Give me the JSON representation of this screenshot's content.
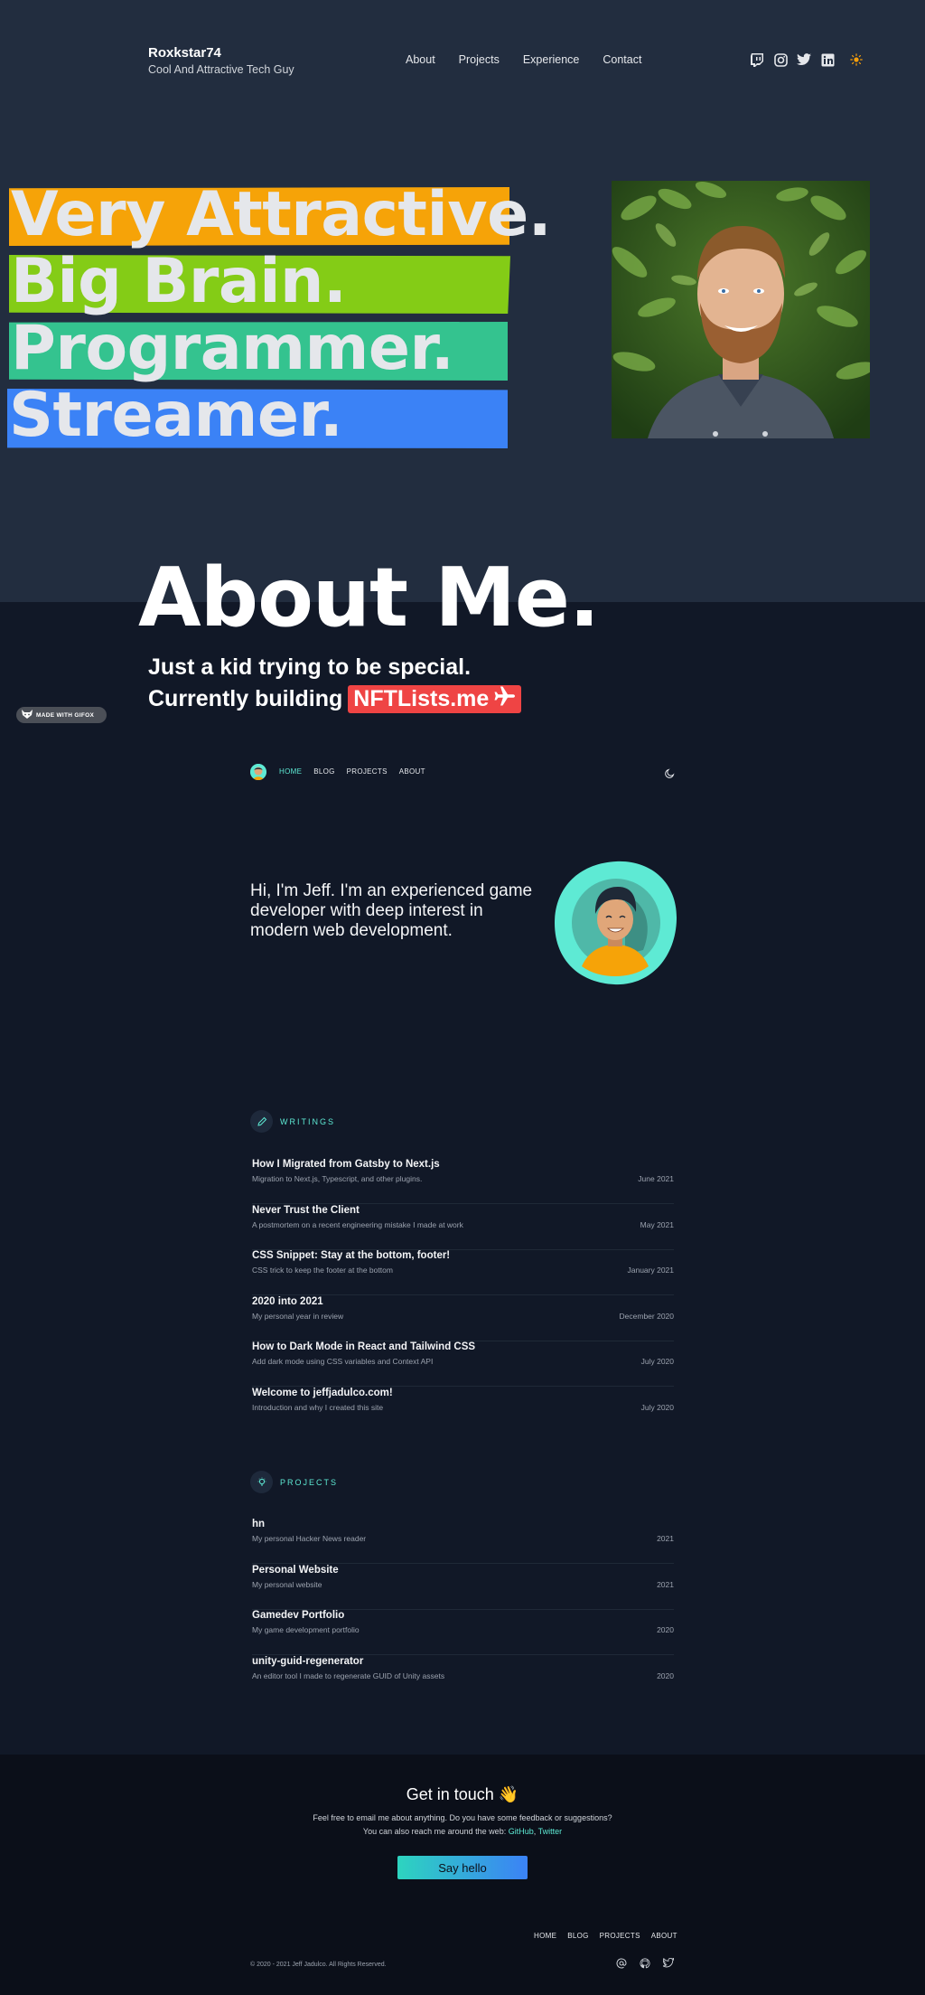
{
  "header": {
    "brand_name": "Roxkstar74",
    "tagline": "Cool And Attractive Tech Guy",
    "nav": [
      "About",
      "Projects",
      "Experience",
      "Contact"
    ]
  },
  "hero": {
    "stripes": [
      {
        "text": "Very Attractive.",
        "color": "#f6a308"
      },
      {
        "text": "Big Brain.",
        "color": "#84cc16"
      },
      {
        "text": "Programmer.",
        "color": "#34c38f"
      },
      {
        "text": "Streamer.",
        "color": "#3b82f6"
      }
    ]
  },
  "about": {
    "title": "About Me.",
    "line1": "Just a kid trying to be special.",
    "line2": "Currently building",
    "badge": "NFTLists.me",
    "badge_emoji": "✈"
  },
  "gifox": {
    "label": "MADE WITH GIFOX"
  },
  "mini_site": {
    "nav": [
      {
        "label": "HOME",
        "active": true
      },
      {
        "label": "BLOG",
        "active": false
      },
      {
        "label": "PROJECTS",
        "active": false
      },
      {
        "label": "ABOUT",
        "active": false
      }
    ],
    "intro": "Hi, I'm Jeff. I'm an experienced game developer with deep interest in modern web development.",
    "writings_label": "WRITINGS",
    "writings": [
      {
        "title": "How I Migrated from Gatsby to Next.js",
        "desc": "Migration to Next.js, Typescript, and other plugins.",
        "date": "June 2021"
      },
      {
        "title": "Never Trust the Client",
        "desc": "A postmortem on a recent engineering mistake I made at work",
        "date": "May 2021"
      },
      {
        "title": "CSS Snippet: Stay at the bottom, footer!",
        "desc": "CSS trick to keep the footer at the bottom",
        "date": "January 2021"
      },
      {
        "title": "2020 into 2021",
        "desc": "My personal year in review",
        "date": "December 2020"
      },
      {
        "title": "How to Dark Mode in React and Tailwind CSS",
        "desc": "Add dark mode using CSS variables and Context API",
        "date": "July 2020"
      },
      {
        "title": "Welcome to jeffjadulco.com!",
        "desc": "Introduction and why I created this site",
        "date": "July 2020"
      }
    ],
    "projects_label": "PROJECTS",
    "projects": [
      {
        "title": "hn",
        "desc": "My personal Hacker News reader",
        "date": "2021"
      },
      {
        "title": "Personal Website",
        "desc": "My personal website",
        "date": "2021"
      },
      {
        "title": "Gamedev Portfolio",
        "desc": "My game development portfolio",
        "date": "2020"
      },
      {
        "title": "unity-guid-regenerator",
        "desc": "An editor tool I made to regenerate GUID of Unity assets",
        "date": "2020"
      }
    ]
  },
  "footer": {
    "title": "Get in touch 👋",
    "p1": "Feel free to email me about anything. Do you have some feedback or suggestions?",
    "p2_prefix": "You can also reach me around the web: ",
    "github": "GitHub",
    "sep": ", ",
    "twitter": "Twitter",
    "button": "Say hello",
    "nav": [
      "HOME",
      "BLOG",
      "PROJECTS",
      "ABOUT"
    ],
    "copyright": "© 2020 - 2021 Jeff Jadulco. All Rights Reserved."
  },
  "colors": {
    "accent": "#5eead4",
    "hero_bg": "#222d3f",
    "page_bg": "#111827",
    "badge": "#ef4444"
  },
  "icons": [
    "twitch-icon",
    "instagram-icon",
    "twitter-icon",
    "linkedin-icon",
    "sun-icon",
    "moon-icon",
    "pencil-icon",
    "lightbulb-icon",
    "at-icon",
    "github-icon",
    "airplane-icon"
  ]
}
